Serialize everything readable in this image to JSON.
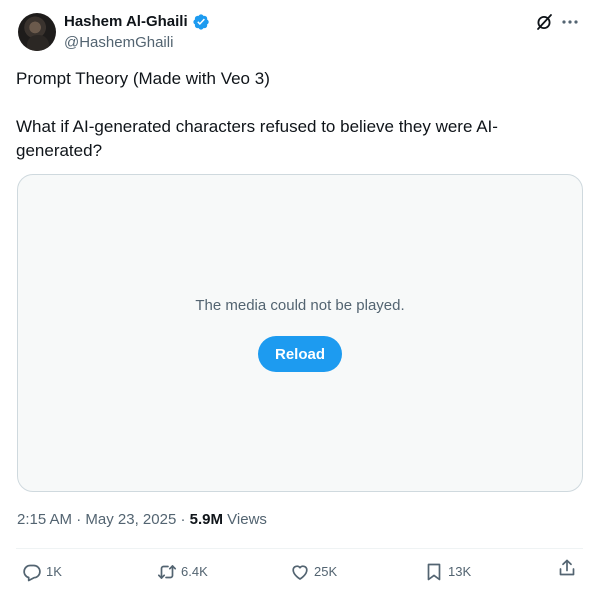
{
  "author": {
    "display_name": "Hashem Al-Ghaili",
    "handle": "@HashemGhaili",
    "verified": true,
    "verified_color": "#1d9bf0"
  },
  "tweet": {
    "line1": "Prompt Theory (Made with Veo 3)",
    "line2": "What if AI-generated characters refused to believe they were AI-generated?"
  },
  "media": {
    "message": "The media could not be played.",
    "reload_label": "Reload"
  },
  "meta": {
    "time": "2:15 AM",
    "date": "May 23, 2025",
    "views": "5.9M",
    "views_label": "Views"
  },
  "actions": {
    "replies": "1K",
    "reposts": "6.4K",
    "likes": "25K",
    "bookmarks": "13K"
  },
  "icons": [
    "grok-icon",
    "more-icon",
    "reply-icon",
    "repost-icon",
    "like-icon",
    "bookmark-icon",
    "share-icon",
    "verified-badge-icon"
  ],
  "colors": {
    "accent": "#1d9bf0",
    "text_primary": "#0f1419",
    "text_secondary": "#536471",
    "border": "#cfd9de",
    "media_bg": "#f7f9f9"
  }
}
